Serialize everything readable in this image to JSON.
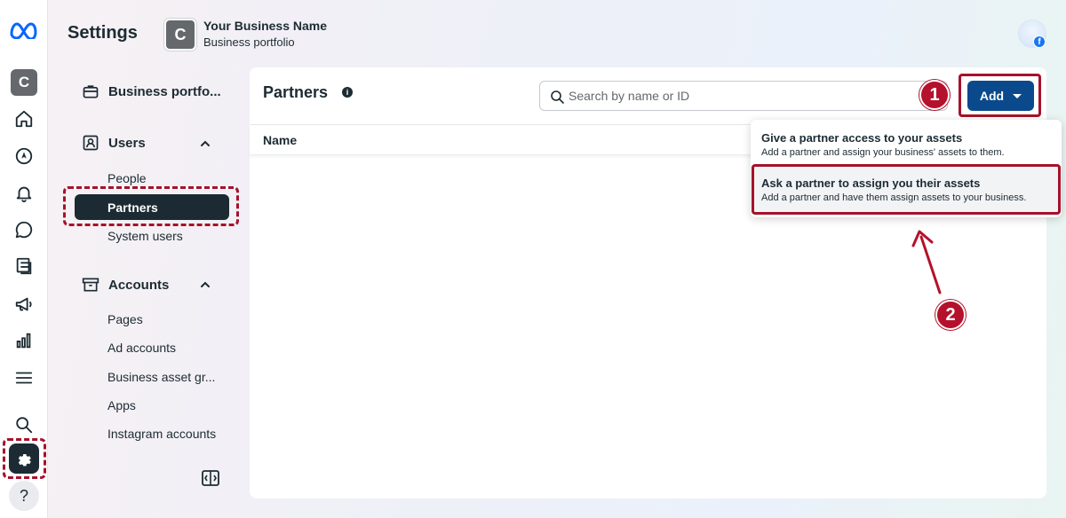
{
  "rail": {
    "workspace_initial": "C",
    "icons": [
      "meta-logo-icon",
      "home-icon",
      "compass-icon",
      "bell-icon",
      "chat-icon",
      "pages-icon",
      "megaphone-icon",
      "bar-chart-icon",
      "menu-icon",
      "search-icon",
      "gear-icon",
      "help-icon"
    ],
    "help_label": "?"
  },
  "header": {
    "title": "Settings",
    "business_initial": "C",
    "business_name": "Your Business Name",
    "business_subtitle": "Business portfolio",
    "profile_badge": "f"
  },
  "nav": {
    "portfolio_label": "Business portfo...",
    "users_label": "Users",
    "users_items": [
      "People",
      "Partners",
      "System users"
    ],
    "accounts_label": "Accounts",
    "accounts_items": [
      "Pages",
      "Ad accounts",
      "Business asset gr...",
      "Apps",
      "Instagram accounts"
    ]
  },
  "main": {
    "title": "Partners",
    "info": "i",
    "search_placeholder": "Search by name or ID",
    "add_label": "Add",
    "column_name": "Name"
  },
  "dropdown": {
    "items": [
      {
        "title": "Give a partner access to your assets",
        "desc": "Add a partner and assign your business' assets to them."
      },
      {
        "title": "Ask a partner to assign you their assets",
        "desc": "Add a partner and have them assign assets to your business."
      }
    ]
  },
  "annotations": {
    "step1": "1",
    "step2": "2",
    "color": "#b5112c"
  },
  "colors": {
    "accent_dark": "#1c2b33",
    "primary_button": "#0a4a8c",
    "facebook_blue": "#1877f2"
  }
}
